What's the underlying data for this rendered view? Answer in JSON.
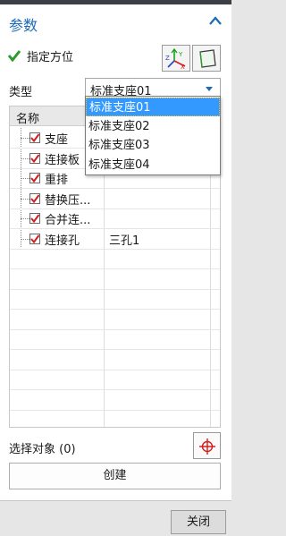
{
  "panel": {
    "title": "参数"
  },
  "orientation": {
    "label": "指定方位"
  },
  "type": {
    "label": "类型",
    "value": "标准支座01",
    "options": [
      "标准支座01",
      "标准支座02",
      "标准支座03",
      "标准支座04"
    ],
    "highlighted_index": 0
  },
  "table": {
    "header": "名称",
    "rows": [
      {
        "name": "支座",
        "value": "",
        "checked": true
      },
      {
        "name": "连接板",
        "value": "",
        "checked": true
      },
      {
        "name": "重排",
        "value": "",
        "checked": true
      },
      {
        "name": "替换压...",
        "value": "",
        "checked": true
      },
      {
        "name": "合并连...",
        "value": "",
        "checked": true
      },
      {
        "name": "连接孔",
        "value": "三孔1",
        "checked": true
      }
    ]
  },
  "select_object": {
    "label": "选择对象 (0)"
  },
  "buttons": {
    "create": "创建",
    "close": "关闭"
  },
  "colors": {
    "accent": "#1f6ab5",
    "highlight": "#3399ff",
    "check_green": "#2e9a2e",
    "checkbox_red": "#d11e1e"
  }
}
